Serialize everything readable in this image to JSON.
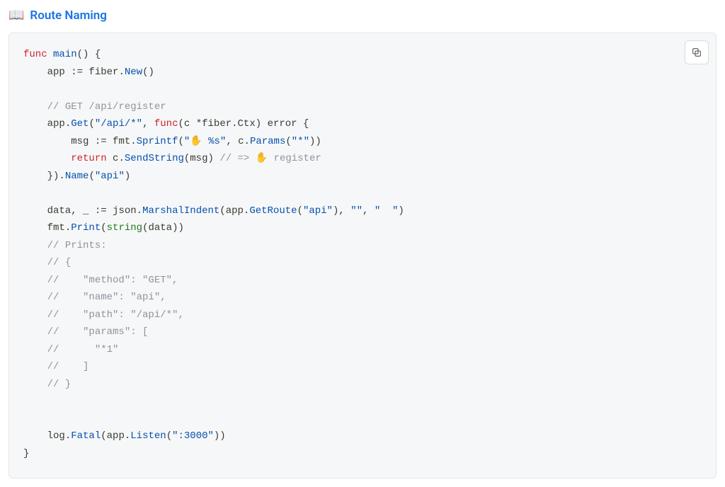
{
  "heading": {
    "icon": "📖",
    "text": "Route Naming",
    "href": "#"
  },
  "copy_button": {
    "aria": "Copy code to clipboard"
  },
  "code": {
    "lines": [
      [
        {
          "t": "func ",
          "c": "tk-kw"
        },
        {
          "t": "main",
          "c": "tk-fnblue"
        },
        {
          "t": "()",
          "c": "tk-punct"
        },
        {
          "t": " {",
          "c": "tk-punct"
        }
      ],
      [
        {
          "t": "    app ",
          "c": "tk-txt"
        },
        {
          "t": ":=",
          "c": "tk-punct"
        },
        {
          "t": " fiber",
          "c": "tk-txt"
        },
        {
          "t": ".",
          "c": "tk-punct"
        },
        {
          "t": "New",
          "c": "tk-fnblue"
        },
        {
          "t": "()",
          "c": "tk-punct"
        }
      ],
      [],
      [
        {
          "t": "    ",
          "c": ""
        },
        {
          "t": "// GET /api/register",
          "c": "tk-cmt"
        }
      ],
      [
        {
          "t": "    app",
          "c": "tk-txt"
        },
        {
          "t": ".",
          "c": "tk-punct"
        },
        {
          "t": "Get",
          "c": "tk-fnblue"
        },
        {
          "t": "(",
          "c": "tk-punct"
        },
        {
          "t": "\"/api/*\"",
          "c": "tk-str"
        },
        {
          "t": ",",
          "c": "tk-punct"
        },
        {
          "t": " ",
          "c": ""
        },
        {
          "t": "func",
          "c": "tk-kw"
        },
        {
          "t": "(",
          "c": "tk-punct"
        },
        {
          "t": "c ",
          "c": "tk-txt"
        },
        {
          "t": "*",
          "c": "tk-punct"
        },
        {
          "t": "fiber",
          "c": "tk-txt"
        },
        {
          "t": ".",
          "c": "tk-punct"
        },
        {
          "t": "Ctx",
          "c": "tk-type"
        },
        {
          "t": ")",
          "c": "tk-punct"
        },
        {
          "t": " ",
          "c": ""
        },
        {
          "t": "error",
          "c": "tk-type"
        },
        {
          "t": " {",
          "c": "tk-punct"
        }
      ],
      [
        {
          "t": "        msg ",
          "c": "tk-txt"
        },
        {
          "t": ":=",
          "c": "tk-punct"
        },
        {
          "t": " fmt",
          "c": "tk-txt"
        },
        {
          "t": ".",
          "c": "tk-punct"
        },
        {
          "t": "Sprintf",
          "c": "tk-fnblue"
        },
        {
          "t": "(",
          "c": "tk-punct"
        },
        {
          "t": "\"✋ %s\"",
          "c": "tk-str"
        },
        {
          "t": ",",
          "c": "tk-punct"
        },
        {
          "t": " c",
          "c": "tk-txt"
        },
        {
          "t": ".",
          "c": "tk-punct"
        },
        {
          "t": "Params",
          "c": "tk-fnblue"
        },
        {
          "t": "(",
          "c": "tk-punct"
        },
        {
          "t": "\"*\"",
          "c": "tk-str"
        },
        {
          "t": "))",
          "c": "tk-punct"
        }
      ],
      [
        {
          "t": "        ",
          "c": ""
        },
        {
          "t": "return",
          "c": "tk-kw"
        },
        {
          "t": " c",
          "c": "tk-txt"
        },
        {
          "t": ".",
          "c": "tk-punct"
        },
        {
          "t": "SendString",
          "c": "tk-fnblue"
        },
        {
          "t": "(",
          "c": "tk-punct"
        },
        {
          "t": "msg",
          "c": "tk-txt"
        },
        {
          "t": ")",
          "c": "tk-punct"
        },
        {
          "t": " ",
          "c": ""
        },
        {
          "t": "// => ✋ register",
          "c": "tk-cmt"
        }
      ],
      [
        {
          "t": "    }",
          "c": "tk-punct"
        },
        {
          "t": ")",
          "c": "tk-punct"
        },
        {
          "t": ".",
          "c": "tk-punct"
        },
        {
          "t": "Name",
          "c": "tk-fnblue"
        },
        {
          "t": "(",
          "c": "tk-punct"
        },
        {
          "t": "\"api\"",
          "c": "tk-str"
        },
        {
          "t": ")",
          "c": "tk-punct"
        }
      ],
      [],
      [
        {
          "t": "    data",
          "c": "tk-txt"
        },
        {
          "t": ",",
          "c": "tk-punct"
        },
        {
          "t": " _",
          "c": "tk-txt"
        },
        {
          "t": " ",
          "c": ""
        },
        {
          "t": ":=",
          "c": "tk-punct"
        },
        {
          "t": " json",
          "c": "tk-txt"
        },
        {
          "t": ".",
          "c": "tk-punct"
        },
        {
          "t": "MarshalIndent",
          "c": "tk-fnblue"
        },
        {
          "t": "(",
          "c": "tk-punct"
        },
        {
          "t": "app",
          "c": "tk-txt"
        },
        {
          "t": ".",
          "c": "tk-punct"
        },
        {
          "t": "GetRoute",
          "c": "tk-fnblue"
        },
        {
          "t": "(",
          "c": "tk-punct"
        },
        {
          "t": "\"api\"",
          "c": "tk-str"
        },
        {
          "t": ")",
          "c": "tk-punct"
        },
        {
          "t": ",",
          "c": "tk-punct"
        },
        {
          "t": " ",
          "c": ""
        },
        {
          "t": "\"\"",
          "c": "tk-str"
        },
        {
          "t": ",",
          "c": "tk-punct"
        },
        {
          "t": " ",
          "c": ""
        },
        {
          "t": "\"  \"",
          "c": "tk-str"
        },
        {
          "t": ")",
          "c": "tk-punct"
        }
      ],
      [
        {
          "t": "    fmt",
          "c": "tk-txt"
        },
        {
          "t": ".",
          "c": "tk-punct"
        },
        {
          "t": "Print",
          "c": "tk-fnblue"
        },
        {
          "t": "(",
          "c": "tk-punct"
        },
        {
          "t": "string",
          "c": "tk-fn"
        },
        {
          "t": "(",
          "c": "tk-punct"
        },
        {
          "t": "data",
          "c": "tk-txt"
        },
        {
          "t": "))",
          "c": "tk-punct"
        }
      ],
      [
        {
          "t": "    ",
          "c": ""
        },
        {
          "t": "// Prints:",
          "c": "tk-cmt"
        }
      ],
      [
        {
          "t": "    ",
          "c": ""
        },
        {
          "t": "// {",
          "c": "tk-cmt"
        }
      ],
      [
        {
          "t": "    ",
          "c": ""
        },
        {
          "t": "//    \"method\": \"GET\",",
          "c": "tk-cmt"
        }
      ],
      [
        {
          "t": "    ",
          "c": ""
        },
        {
          "t": "//    \"name\": \"api\",",
          "c": "tk-cmt"
        }
      ],
      [
        {
          "t": "    ",
          "c": ""
        },
        {
          "t": "//    \"path\": \"/api/*\",",
          "c": "tk-cmt"
        }
      ],
      [
        {
          "t": "    ",
          "c": ""
        },
        {
          "t": "//    \"params\": [",
          "c": "tk-cmt"
        }
      ],
      [
        {
          "t": "    ",
          "c": ""
        },
        {
          "t": "//      \"*1\"",
          "c": "tk-cmt"
        }
      ],
      [
        {
          "t": "    ",
          "c": ""
        },
        {
          "t": "//    ]",
          "c": "tk-cmt"
        }
      ],
      [
        {
          "t": "    ",
          "c": ""
        },
        {
          "t": "// }",
          "c": "tk-cmt"
        }
      ],
      [],
      [],
      [
        {
          "t": "    log",
          "c": "tk-txt"
        },
        {
          "t": ".",
          "c": "tk-punct"
        },
        {
          "t": "Fatal",
          "c": "tk-fnblue"
        },
        {
          "t": "(",
          "c": "tk-punct"
        },
        {
          "t": "app",
          "c": "tk-txt"
        },
        {
          "t": ".",
          "c": "tk-punct"
        },
        {
          "t": "Listen",
          "c": "tk-fnblue"
        },
        {
          "t": "(",
          "c": "tk-punct"
        },
        {
          "t": "\":3000\"",
          "c": "tk-str"
        },
        {
          "t": "))",
          "c": "tk-punct"
        }
      ],
      [
        {
          "t": "}",
          "c": "tk-punct"
        }
      ]
    ]
  }
}
